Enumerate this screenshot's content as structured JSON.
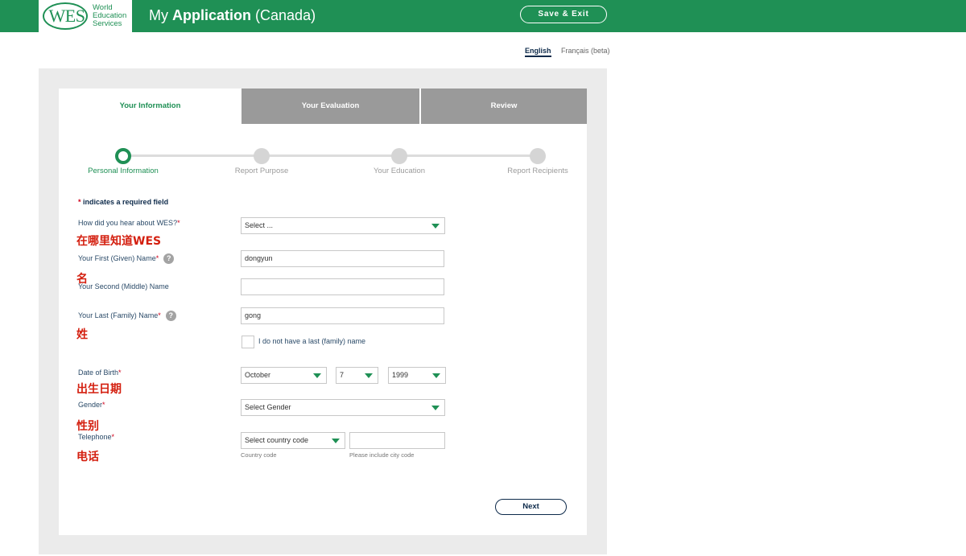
{
  "header": {
    "logo_mark": "WES",
    "logo_words": [
      "World",
      "Education",
      "Services"
    ],
    "title_prefix": "My",
    "title_bold": "Application",
    "title_suffix": "(Canada)",
    "save_exit_label": "Save & Exit",
    "bg_color": "#1f9055"
  },
  "language": {
    "english": "English",
    "french": "Français (beta)"
  },
  "tabs": [
    {
      "label": "Your Information",
      "active": true
    },
    {
      "label": "Your Evaluation",
      "active": false
    },
    {
      "label": "Review",
      "active": false
    }
  ],
  "steps": [
    {
      "label": "Personal Information",
      "active": true
    },
    {
      "label": "Report Purpose",
      "active": false
    },
    {
      "label": "Your Education",
      "active": false
    },
    {
      "label": "Report Recipients",
      "active": false
    }
  ],
  "form": {
    "required_star": "*",
    "required_note": "indicates a required field",
    "hear_about": {
      "label": "How did you hear about WES?",
      "value": "Select ...",
      "annotation": "在哪里知道WES"
    },
    "first_name": {
      "label": "Your First (Given) Name",
      "value": "dongyun",
      "annotation": "名"
    },
    "middle_name": {
      "label": "Your Second (Middle) Name",
      "value": ""
    },
    "last_name": {
      "label": "Your Last (Family) Name",
      "value": "gong",
      "annotation": "姓"
    },
    "no_last_name": {
      "label": "I do not have a last (family) name",
      "checked": false
    },
    "dob": {
      "label": "Date of Birth",
      "month": "October",
      "day": "7",
      "year": "1999",
      "annotation": "出生日期"
    },
    "gender": {
      "label": "Gender",
      "value": "Select Gender",
      "annotation": "性别"
    },
    "telephone": {
      "label": "Telephone",
      "country_code_value": "Select country code",
      "country_code_hint": "Country code",
      "number_value": "",
      "number_hint": "Please include city code",
      "annotation": "电话"
    },
    "help_icon": "?",
    "next_label": "Next"
  }
}
